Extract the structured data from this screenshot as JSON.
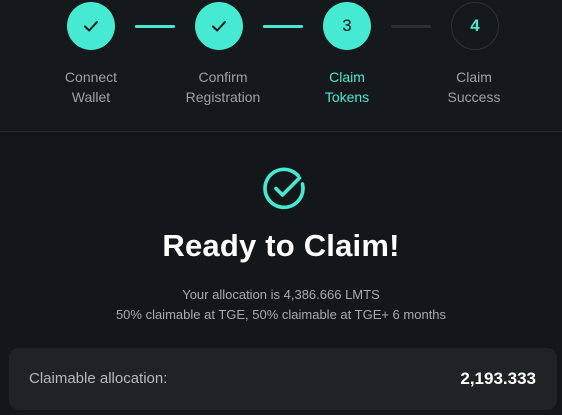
{
  "stepper": {
    "steps": [
      {
        "number": "1",
        "status": "done",
        "label_line1": "Connect",
        "label_line2": "Wallet"
      },
      {
        "number": "2",
        "status": "done",
        "label_line1": "Confirm",
        "label_line2": "Registration"
      },
      {
        "number": "3",
        "status": "active",
        "label_line1": "Claim",
        "label_line2": "Tokens"
      },
      {
        "number": "4",
        "status": "pending",
        "label_line1": "Claim",
        "label_line2": "Success"
      }
    ]
  },
  "main": {
    "icon": "check-circle-icon",
    "title": "Ready to Claim!",
    "allocation_text": "Your allocation is 4,386.666 LMTS",
    "schedule_text": "50% claimable at TGE, 50% claimable at TGE+ 6 months",
    "claimable_label": "Claimable allocation:",
    "claimable_value": "2,193.333"
  },
  "colors": {
    "accent": "#46ead2",
    "background": "#141719",
    "card": "#1f2326",
    "muted_text": "#9aa1a6"
  }
}
